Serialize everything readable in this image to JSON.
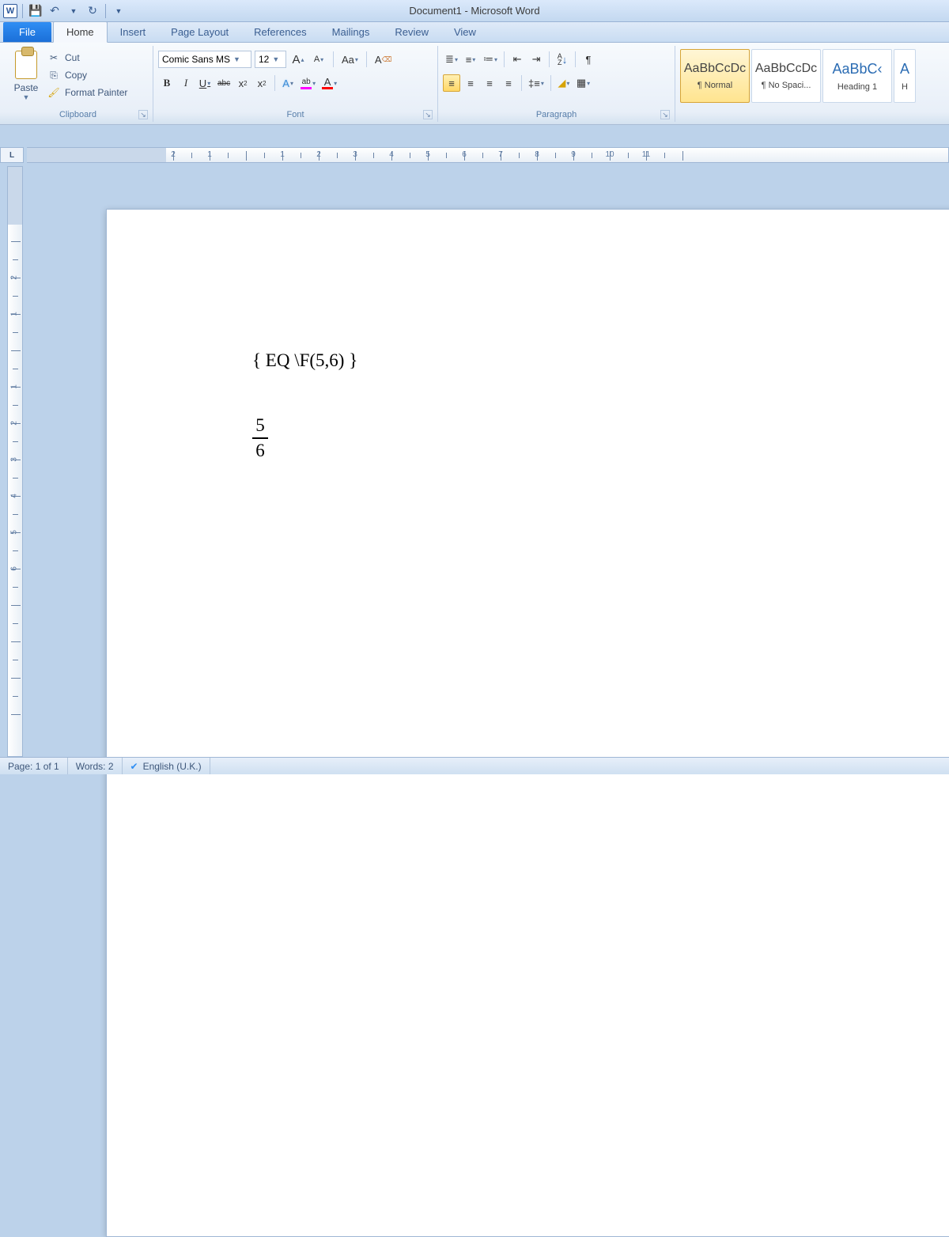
{
  "app": {
    "title": "Document1 - Microsoft Word"
  },
  "qat": {
    "save": "💾",
    "undo": "↶",
    "redo": "↻"
  },
  "tabs": {
    "file": "File",
    "items": [
      "Home",
      "Insert",
      "Page Layout",
      "References",
      "Mailings",
      "Review",
      "View"
    ],
    "active": 0
  },
  "clipboard": {
    "paste": "Paste",
    "cut": "Cut",
    "copy": "Copy",
    "format_painter": "Format Painter",
    "group_label": "Clipboard"
  },
  "font": {
    "name": "Comic Sans MS",
    "size": "12",
    "bold": "B",
    "italic": "I",
    "underline": "U",
    "strike": "abc",
    "sub": "x",
    "sup": "x",
    "grow": "A",
    "shrink": "A",
    "case": "Aa",
    "clear": "⌫",
    "effects": "A",
    "highlight": "ab",
    "color": "A",
    "group_label": "Font"
  },
  "paragraph": {
    "group_label": "Paragraph",
    "sort": "A",
    "pilcrow": "¶",
    "shading": "◢",
    "borders": "▦"
  },
  "styles": {
    "sample": "AaBbCcDc",
    "normal": "¶ Normal",
    "nospacing": "¶ No Spaci...",
    "heading1_sample": "AaBbC‹",
    "heading1": "Heading 1",
    "more_sample": "A",
    "more": "H"
  },
  "ruler": {
    "top_numbers": [
      "2",
      "1",
      "1",
      "2",
      "3",
      "4",
      "5",
      "6",
      "7",
      "8",
      "9",
      "10",
      "11"
    ],
    "left_numbers": [
      "2",
      "1",
      "1",
      "2",
      "3",
      "4",
      "5",
      "6"
    ]
  },
  "document": {
    "field_code": "{ EQ \\F(5,6) }",
    "fraction_num": "5",
    "fraction_den": "6"
  },
  "status": {
    "page": "Page: 1 of 1",
    "words": "Words: 2",
    "language": "English (U.K.)"
  }
}
